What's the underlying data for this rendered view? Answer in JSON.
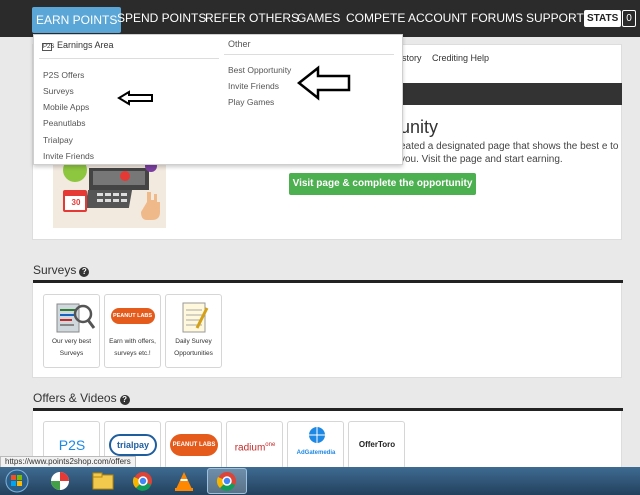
{
  "nav": {
    "items": [
      "EARN POINTS",
      "SPEND POINTS",
      "REFER OTHERS",
      "GAMES",
      "COMPETE",
      "ACCOUNT",
      "FORUMS",
      "SUPPORT"
    ],
    "stats": "STATS",
    "count": "0"
  },
  "subnav": {
    "history": "istory",
    "crediting": "Crediting Help"
  },
  "hero": {
    "title": "unity",
    "text": "eated a designated page that shows the best e to you. Visit the page and start earning.",
    "button": "Visit page & complete the opportunity",
    "calendar_day": "30"
  },
  "dropdown": {
    "earnings_title": "Earnings Area",
    "earnings_icon": "P2S",
    "earnings_links": [
      "P2S Offers",
      "Surveys",
      "Mobile Apps",
      "Peanutlabs",
      "Trialpay",
      "Invite Friends"
    ],
    "other_title": "Other",
    "other_links": [
      "Best Opportunity",
      "Invite Friends",
      "Play Games"
    ]
  },
  "surveys": {
    "title": "Surveys",
    "tiles": [
      {
        "caption": "Our very best Surveys",
        "icon": "survey-clipboard-icon"
      },
      {
        "caption": "Earn with offers, surveys etc.!",
        "icon": "peanut-labs-logo",
        "logo_text": "PEANUT LABS"
      },
      {
        "caption": "Daily Survey Opportunities",
        "icon": "notepad-icon"
      }
    ]
  },
  "offers": {
    "title": "Offers & Videos",
    "tiles": [
      {
        "name": "p2s",
        "text": "P2S"
      },
      {
        "name": "trialpay",
        "text": "trialpay"
      },
      {
        "name": "peanutlabs",
        "text": "PEANUT LABS"
      },
      {
        "name": "radiumone",
        "text": "radium",
        "sup": "one"
      },
      {
        "name": "adgatemedia",
        "text": "AdGatemedia"
      },
      {
        "name": "offertoro",
        "text": "OfferToro"
      }
    ]
  },
  "status_url": "https://www.points2shop.com/offers",
  "colors": {
    "nav_bg": "#2b2b2b",
    "nav_active": "#5aa6d6",
    "button_green": "#4caf50"
  }
}
